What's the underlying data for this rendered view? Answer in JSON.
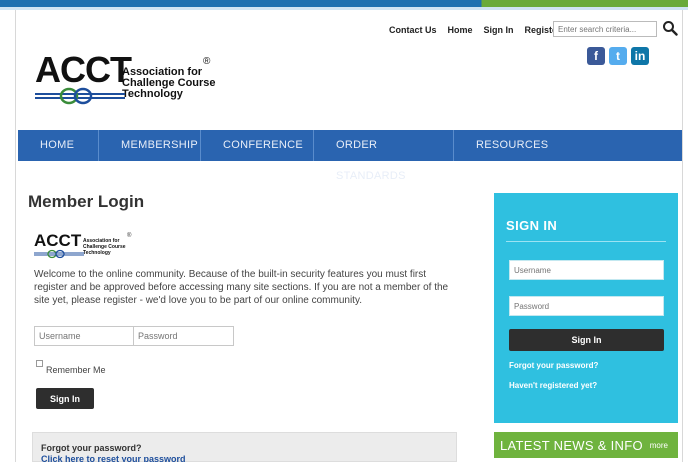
{
  "header": {
    "links": [
      "Contact Us",
      "Home",
      "Sign In",
      "Register"
    ],
    "search_placeholder": "Enter search criteria..."
  },
  "logo": {
    "main": "ACCT",
    "subtitle_lines": [
      "Association for",
      "Challenge Course",
      "Technology"
    ],
    "registered": "®"
  },
  "social": {
    "facebook": "f",
    "twitter": "t",
    "linkedin": "in"
  },
  "nav": {
    "items": [
      "Home",
      "Membership",
      "Conference",
      "Order Standards",
      "Resources"
    ]
  },
  "main": {
    "title": "Member Login",
    "welcome_text": "Welcome to the online community. Because of the built-in security features you must first register and be approved before accessing many site sections. If you are not a member of the site yet, please register - we'd love you to be part of our online community.",
    "username_placeholder": "Username",
    "password_placeholder": "Password",
    "remember_label": "Remember Me",
    "signin_label": "Sign In",
    "forgot_question": "Forgot your password?",
    "forgot_link": "Click here to reset your password"
  },
  "sidebar": {
    "title": "SIGN IN",
    "username_placeholder": "Username",
    "password_placeholder": "Password",
    "signin_label": "Sign In",
    "forgot_label": "Forgot your password?",
    "register_label": "Haven't registered yet?"
  },
  "news": {
    "title": "LATEST NEWS & INFO",
    "more": "more"
  },
  "colors": {
    "nav_blue": "#2a64b0",
    "sidebar_cyan": "#2fc0e0",
    "news_green": "#6fb33e",
    "button_dark": "#2e2e2e"
  }
}
